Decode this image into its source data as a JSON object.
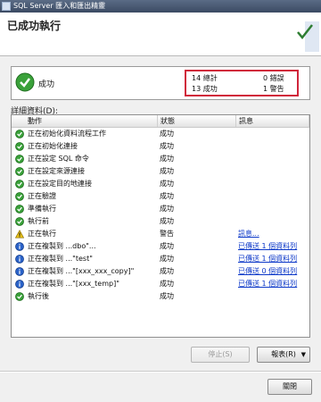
{
  "window": {
    "title": "SQL Server 匯入和匯出精靈"
  },
  "header": {
    "title": "已成功執行"
  },
  "summary": {
    "status": "成功",
    "stats": {
      "total_value": "14",
      "total_label": "總計",
      "success_value": "13",
      "success_label": "成功",
      "error_value": "0",
      "error_label": "錯誤",
      "warning_value": "1",
      "warning_label": "警告"
    }
  },
  "details": {
    "label": "詳細資料(D):",
    "columns": [
      "動作",
      "狀態",
      "訊息"
    ],
    "rows": [
      {
        "icon": "success",
        "action": "正在初始化資料流程工作",
        "status": "成功",
        "message": ""
      },
      {
        "icon": "success",
        "action": "正在初始化連接",
        "status": "成功",
        "message": ""
      },
      {
        "icon": "success",
        "action": "正在設定 SQL 命令",
        "status": "成功",
        "message": ""
      },
      {
        "icon": "success",
        "action": "正在設定來源連接",
        "status": "成功",
        "message": ""
      },
      {
        "icon": "success",
        "action": "正在設定目的地連接",
        "status": "成功",
        "message": ""
      },
      {
        "icon": "success",
        "action": "正在驗證",
        "status": "成功",
        "message": ""
      },
      {
        "icon": "success",
        "action": "準備執行",
        "status": "成功",
        "message": ""
      },
      {
        "icon": "success",
        "action": "執行前",
        "status": "成功",
        "message": ""
      },
      {
        "icon": "warning",
        "action": "正在執行",
        "status": "警告",
        "message": "訊息..."
      },
      {
        "icon": "info",
        "action": "正在複製到 ...dbo\"...",
        "status": "成功",
        "message": "已傳送 1 個資料列"
      },
      {
        "icon": "info",
        "action": "正在複製到 ...\"test\"",
        "status": "成功",
        "message": "已傳送 1 個資料列"
      },
      {
        "icon": "info",
        "action": "正在複製到 ...\"[xxx_xxx_copy]\"",
        "status": "成功",
        "message": "已傳送 0 個資料列"
      },
      {
        "icon": "info",
        "action": "正在複製到 ...\"[xxx_temp]\"",
        "status": "成功",
        "message": "已傳送 1 個資料列"
      },
      {
        "icon": "success",
        "action": "執行後",
        "status": "成功",
        "message": ""
      }
    ]
  },
  "buttons": {
    "stop": "停止(S)",
    "report": "報表(R)",
    "close": "關閉"
  },
  "colors": {
    "highlight": "#d0243a",
    "success": "#3aa13a",
    "warning": "#e8c21a",
    "info": "#2b63c9",
    "link": "#0b37c8"
  }
}
